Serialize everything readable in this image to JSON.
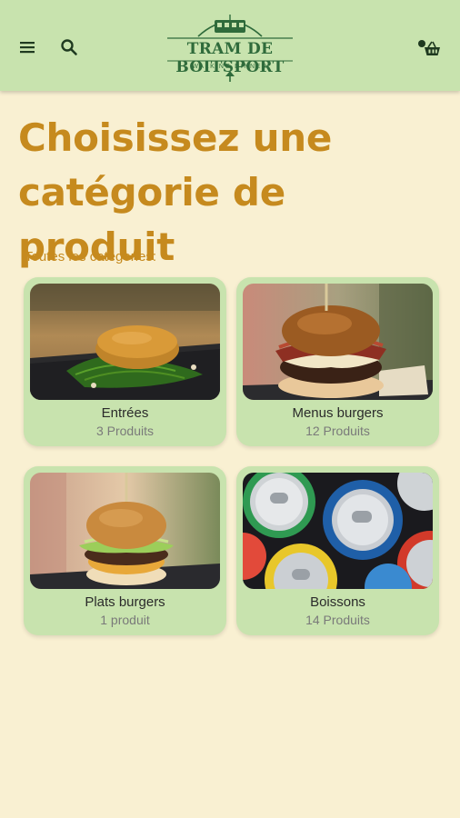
{
  "header": {
    "logo": {
      "title": "TRAM DE BOITSPORT",
      "subtitle": "WALKING DINNER"
    },
    "icons": {
      "menu": "menu-icon",
      "search": "search-icon",
      "cart": "cart-icon"
    }
  },
  "page": {
    "title": "Choisissez une catégorie de produit",
    "section_label": "Toutes les catégories:"
  },
  "categories": [
    {
      "name": "Entrées",
      "count": "3 Produits",
      "image": "croquette on arugula"
    },
    {
      "name": "Menus burgers",
      "count": "12 Produits",
      "image": "bacon cheeseburger"
    },
    {
      "name": "Plats burgers",
      "count": "1 produit",
      "image": "burger with lettuce"
    },
    {
      "name": "Boissons",
      "count": "14 Produits",
      "image": "soda cans"
    }
  ],
  "colors": {
    "background": "#f9f0d2",
    "header": "#c8e3ae",
    "accent": "#c68a1e",
    "logo_green": "#2f6b3b"
  }
}
